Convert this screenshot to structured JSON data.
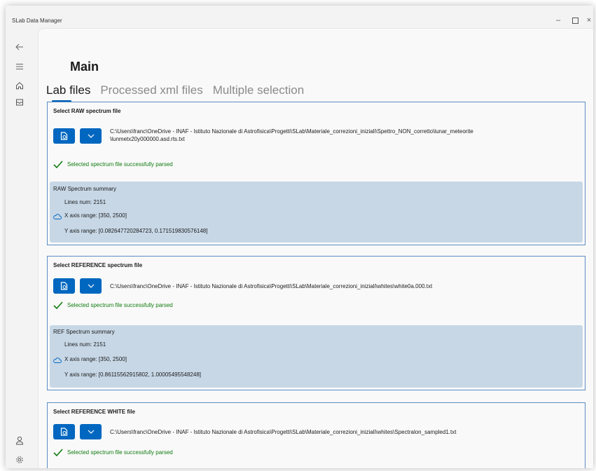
{
  "window": {
    "title": "SLab Data Manager",
    "controls": {
      "minimize": "–",
      "close": "×"
    }
  },
  "nav": {
    "icons": [
      "back-icon",
      "hamburger-icon",
      "home-icon",
      "archive-icon",
      "person-icon",
      "settings-icon"
    ]
  },
  "page": {
    "title": "Main"
  },
  "tabs": [
    {
      "label": "Lab files",
      "active": true
    },
    {
      "label": "Processed xml files",
      "active": false
    },
    {
      "label": "Multiple selection",
      "active": false
    }
  ],
  "sections": {
    "raw": {
      "title": "Select RAW spectrum file",
      "path_line1": "C:\\Users\\franc\\OneDrive - INAF - Istituto Nazionale di Astrofisica\\Progetti\\SLab\\Materiale_correzioni_iniziali\\Spettro_NON_corretto\\lunar_meteorite",
      "path_line2": "\\lunmetx20y000000.asd.rts.txt",
      "status": "Selected spectrum file successfully parsed",
      "summary_title": "RAW Spectrum summary",
      "lines": "Lines num: 2151",
      "x_range": "X axis range: [350, 2500]",
      "y_range": "Y axis range: [0.082647720284723, 0.171519830576148]"
    },
    "ref": {
      "title": "Select REFERENCE spectrum file",
      "path": "C:\\Users\\franc\\OneDrive - INAF - Istituto Nazionale di Astrofisica\\Progetti\\SLab\\Materiale_correzioni_iniziali\\whites\\white0a.000.txt",
      "status": "Selected spectrum file successfully parsed",
      "summary_title": "REF Spectrum summary",
      "lines": "Lines num: 2151",
      "x_range": "X axis range: [350, 2500]",
      "y_range": "Y axis range: [0.86115562915802, 1.00005495548248]"
    },
    "white": {
      "title": "Select REFERENCE WHITE file",
      "path": "C:\\Users\\franc\\OneDrive - INAF - Istituto Nazionale di Astrofisica\\Progetti\\SLab\\Materiale_correzioni_iniziali\\whites\\Spectralon_sampled1.txt",
      "status": "Selected spectrum file successfully parsed"
    }
  },
  "colors": {
    "accent": "#0067c0",
    "success": "#107c10",
    "summary_bg": "#c7d7e6",
    "section_border": "#5b8cc4"
  }
}
